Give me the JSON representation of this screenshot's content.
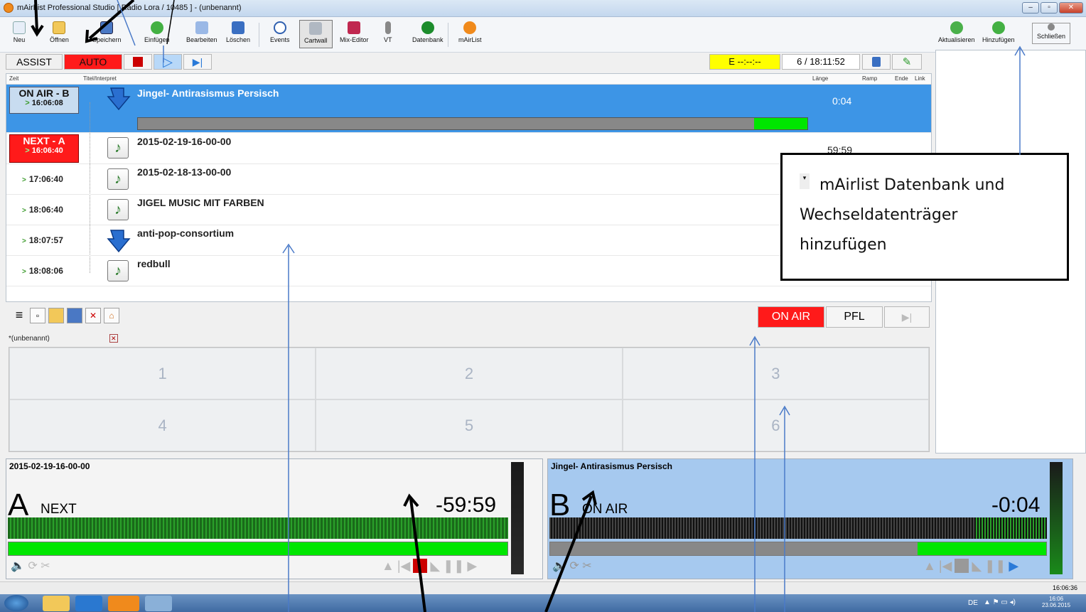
{
  "window": {
    "title": "mAirList Professional Studio [ Radio Lora / 10485 ] - (unbenannt)"
  },
  "toolbar": {
    "items": [
      "Neu",
      "Öffnen",
      "Speichern",
      "Einfügen",
      "Bearbeiten",
      "Löschen",
      "Events",
      "Cartwall",
      "Mix-Editor",
      "VT",
      "Datenbank",
      "mAirList"
    ],
    "right_items": [
      "Aktualisieren",
      "Hinzufügen",
      "Schließen"
    ]
  },
  "controls": {
    "assist": "ASSIST",
    "auto": "AUTO",
    "end_time": "E --:--:--",
    "count_time": "6 / 18:11:52"
  },
  "playlist": {
    "headers": {
      "zeit": "Zeit",
      "titel": "Titel/Interpret",
      "laenge": "Länge",
      "ramp": "Ramp",
      "ende": "Ende",
      "link": "Link"
    },
    "onair": {
      "label": "ON AIR - B",
      "time": "16:06:08",
      "title": "Jingel- Antirasismus Persisch",
      "duration": "0:04",
      "progress": 0.92
    },
    "next": {
      "label": "NEXT - A",
      "time": "16:06:40",
      "title": "2015-02-19-16-00-00",
      "duration": "59:59"
    },
    "rows": [
      {
        "time": "17:06:40",
        "title": "2015-02-18-13-00-00"
      },
      {
        "time": "18:06:40",
        "title": "JIGEL MUSIC MIT FARBEN"
      },
      {
        "time": "18:07:57",
        "title": "anti-pop-consortium"
      },
      {
        "time": "18:08:06",
        "title": "redbull"
      }
    ]
  },
  "callout": {
    "line1": "mAirlist Datenbank  und",
    "line2": "Wechseldatenträger",
    "line3": "hinzufügen"
  },
  "cartwall": {
    "onair": "ON AIR",
    "pfl": "PFL",
    "tab": "*(unbenannt)",
    "slots": [
      "1",
      "2",
      "3",
      "4",
      "5",
      "6"
    ]
  },
  "player_a": {
    "name": "2015-02-19-16-00-00",
    "letter": "A",
    "state": "NEXT",
    "remaining": "-59:59",
    "progress": 1.0
  },
  "player_b": {
    "name": "Jingel- Antirasismus Persisch",
    "letter": "B",
    "state": "ON AIR",
    "remaining": "-0:04",
    "progress": 0.26
  },
  "status": {
    "clock": "16:06:36"
  },
  "taskbar": {
    "lang": "DE",
    "time": "16:06",
    "date": "23.06.2015"
  },
  "colors": {
    "onair_blue": "#3d95e6",
    "next_red": "#ff1a1a",
    "green": "#00e600",
    "yellow": "#ffff00"
  }
}
